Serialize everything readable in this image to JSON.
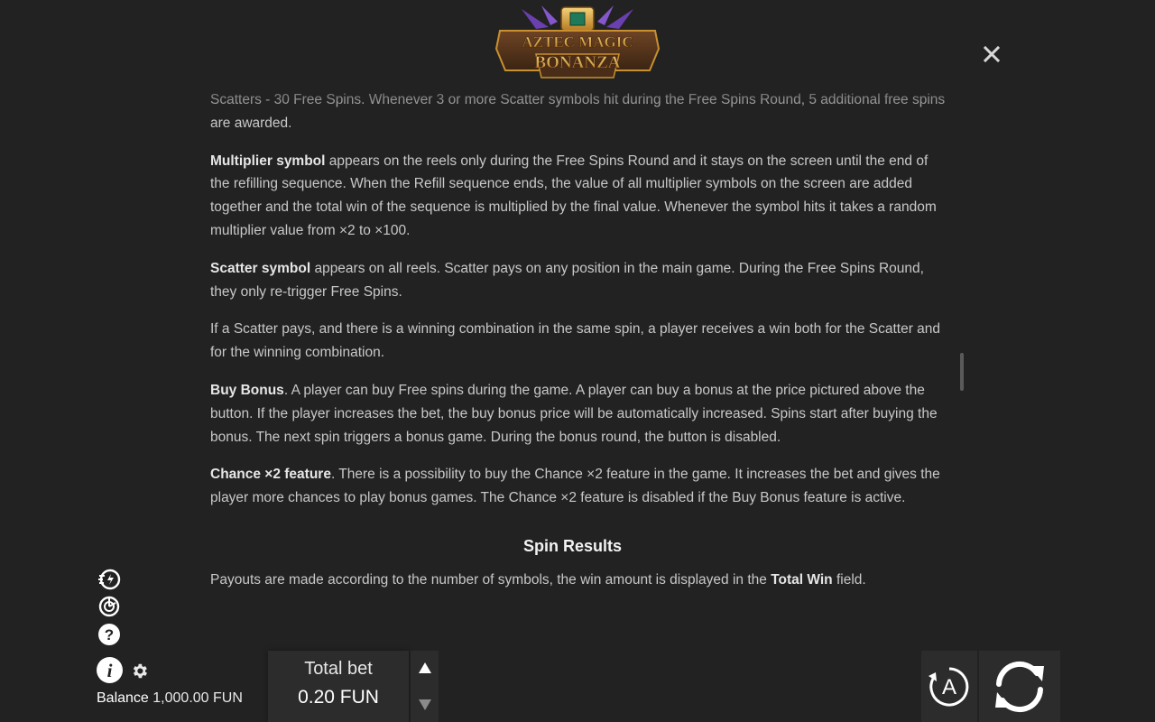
{
  "logo": {
    "line1": "AZTEC MAGIC",
    "line2": "BONANZA"
  },
  "icons": {
    "close": "close-icon",
    "turbo": "turbo-speed-icon",
    "history": "game-history-icon",
    "help": "help-icon",
    "info": "info-icon",
    "settings": "gear-icon",
    "autoplay": "autoplay-icon",
    "spin": "spin-icon",
    "bet_up": "arrow-up-icon",
    "bet_down": "arrow-down-icon"
  },
  "rules": {
    "p0_text": "Scatters - 30 Free Spins. Whenever 3 or more Scatter symbols hit during the Free Spins Round, 5 additional free spins are awarded.",
    "p1_bold": "Multiplier symbol",
    "p1_text": " appears on the reels only during the Free Spins Round and it stays on the screen until the end of the refilling sequence. When the Refill sequence ends, the value of all multiplier symbols on the screen are added together and the total win of the sequence is multiplied by the final value. Whenever the symbol hits it takes a random multiplier value from ×2 to ×100.",
    "p2_bold": "Scatter symbol",
    "p2_text": " appears on all reels. Scatter pays on any position in the main game. During the Free Spins Round, they only re-trigger Free Spins.",
    "p3_text": "If a Scatter pays, and there is a winning combination in the same spin, a player receives a win both for the Scatter and for the winning combination.",
    "p4_bold": "Buy Bonus",
    "p4_text": ". A player can buy Free spins during the game. A player can buy a bonus at the price pictured above the button. If the player increases the bet, the buy bonus price will be automatically increased. Spins start after buying the bonus. The next spin triggers a bonus game. During the bonus round, the button is disabled.",
    "p5_bold": "Chance ×2 feature",
    "p5_text": ". There is a possibility to buy the Chance ×2 feature in the game. It increases the bet and gives the player more chances to play bonus games. The Chance ×2 feature is disabled if the Buy Bonus feature is active.",
    "section_title": "Spin Results",
    "p6_text_a": "Payouts are made according to the number of symbols, the win amount is displayed in the ",
    "p6_bold": "Total Win",
    "p6_text_b": " field."
  },
  "footer": {
    "balance_label": "Balance",
    "balance_value": "1,000.00 FUN",
    "total_bet_label": "Total bet",
    "total_bet_value": "0.20 FUN",
    "autoplay_letter": "A"
  },
  "colors": {
    "background": "#222222",
    "panel": "#2c2c2c",
    "text": "#c8c8c8",
    "logo_gold": "#e7b24a",
    "logo_purple": "#6a3fb0"
  }
}
